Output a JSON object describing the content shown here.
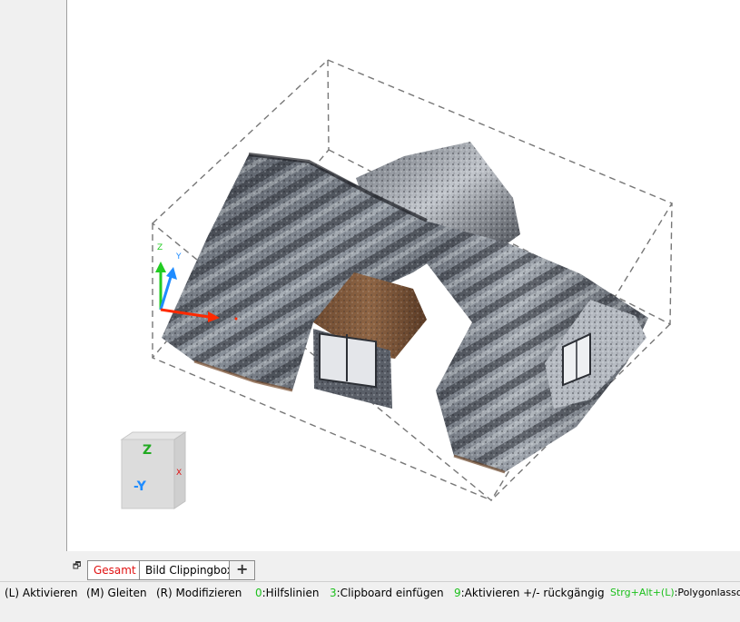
{
  "colors": {
    "active_tab": "#e01010",
    "hotkey": "#1ec01e",
    "axis_x": "#ff2a00",
    "axis_y": "#1f8cff",
    "axis_z": "#22cc22"
  },
  "viewport": {
    "axis_labels": {
      "z": "Z",
      "y": "Y"
    },
    "view_cube": {
      "top_face": "Z",
      "front_face": "-Y",
      "side_face": "X"
    }
  },
  "tabs": {
    "restore_icon": "restore-window-icon",
    "items": [
      {
        "label": "Gesamt",
        "active": true
      },
      {
        "label": "Bild Clippingbox",
        "active": false
      }
    ],
    "add_label": "+"
  },
  "statusbar": {
    "hints": [
      {
        "key": "",
        "text": "(L) Aktivieren"
      },
      {
        "key": "",
        "text": "(M) Gleiten"
      },
      {
        "key": "",
        "text": "(R) Modifizieren"
      },
      {
        "key": "0",
        "text": ":Hilfslinien"
      },
      {
        "key": "3",
        "text": ":Clipboard einfügen"
      },
      {
        "key": "9",
        "text": ":Aktivieren +/- rückgängig"
      },
      {
        "key": "Strg+Alt+(L)",
        "text": ":Polygonlasso"
      }
    ]
  }
}
